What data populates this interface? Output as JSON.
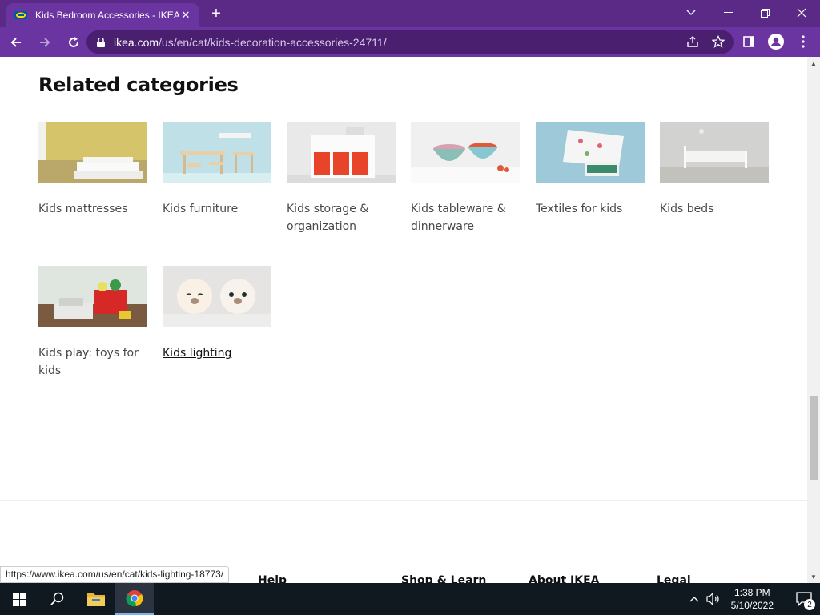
{
  "browser": {
    "tab_title": "Kids Bedroom Accessories - IKEA",
    "url_host": "ikea.com",
    "url_path": "/us/en/cat/kids-decoration-accessories-24711/",
    "status_url": "https://www.ikea.com/us/en/cat/kids-lighting-18773/"
  },
  "page": {
    "heading": "Related categories",
    "categories": [
      {
        "label": "Kids mattresses"
      },
      {
        "label": "Kids furniture"
      },
      {
        "label": "Kids storage & organization"
      },
      {
        "label": "Kids tableware & dinnerware"
      },
      {
        "label": "Textiles for kids"
      },
      {
        "label": "Kids beds"
      },
      {
        "label": "Kids play: toys for kids"
      },
      {
        "label": "Kids lighting"
      }
    ],
    "footer": [
      "Help",
      "Shop & Learn",
      "About IKEA",
      "Legal"
    ]
  },
  "taskbar": {
    "time": "1:38 PM",
    "date": "5/10/2022",
    "notifications": "2"
  },
  "colors": {
    "chrome_frame": "#5b2a87",
    "chrome_toolbar": "#6a35a0",
    "taskbar": "#101820"
  }
}
